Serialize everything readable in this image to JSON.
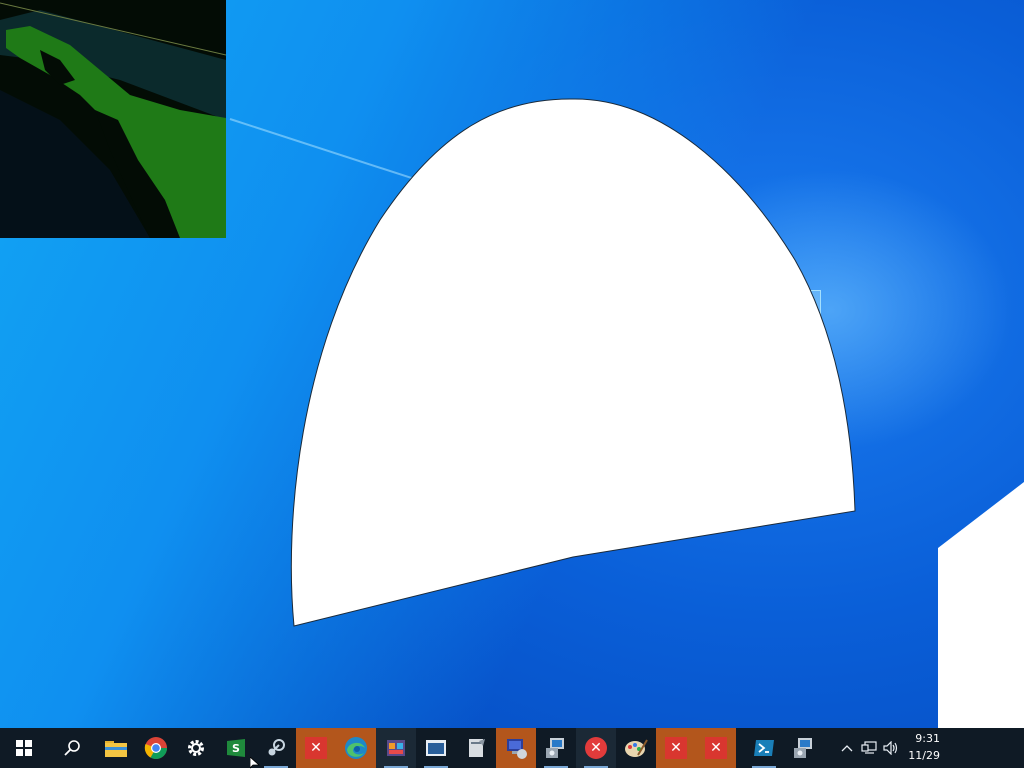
{
  "desktop": {
    "background_colors": {
      "light": "#12a6f4",
      "mid": "#0a5fd8",
      "dark": "#0344b8"
    },
    "overlay_shape_color": "#ffffff"
  },
  "thumbnail": {
    "colors": {
      "background": "#030c05",
      "green": "#1f7a17",
      "teal": "#0c3a3d"
    }
  },
  "taskbar": {
    "background": "#0f1a25",
    "items": [
      {
        "name": "start-button",
        "icon": "windows-logo-icon"
      },
      {
        "name": "search-button",
        "icon": "search-icon"
      },
      {
        "name": "file-explorer",
        "icon": "folder-icon"
      },
      {
        "name": "chrome",
        "icon": "chrome-icon"
      },
      {
        "name": "settings",
        "icon": "gear-icon"
      },
      {
        "name": "app-s",
        "icon": "green-s-icon"
      },
      {
        "name": "steam",
        "icon": "steam-icon"
      },
      {
        "name": "error-app-1",
        "icon": "error-icon"
      },
      {
        "name": "edge",
        "icon": "edge-icon"
      },
      {
        "name": "media-app",
        "icon": "media-icon"
      },
      {
        "name": "window-app",
        "icon": "window-icon"
      },
      {
        "name": "document-app",
        "icon": "document-icon"
      },
      {
        "name": "network-app",
        "icon": "computer-icon"
      },
      {
        "name": "installer-app-1",
        "icon": "installer-icon"
      },
      {
        "name": "error-app-2",
        "icon": "error-icon"
      },
      {
        "name": "paint-app",
        "icon": "paint-palette-icon"
      },
      {
        "name": "error-app-3",
        "icon": "error-icon"
      },
      {
        "name": "error-app-4",
        "icon": "error-icon"
      },
      {
        "name": "powershell",
        "icon": "powershell-icon"
      },
      {
        "name": "installer-app-2",
        "icon": "installer-icon"
      }
    ],
    "tray": {
      "chevron": "^",
      "network_icon": "network-icon",
      "volume_icon": "volume-icon"
    },
    "clock": {
      "time": "9:31",
      "date": "11/29"
    }
  }
}
